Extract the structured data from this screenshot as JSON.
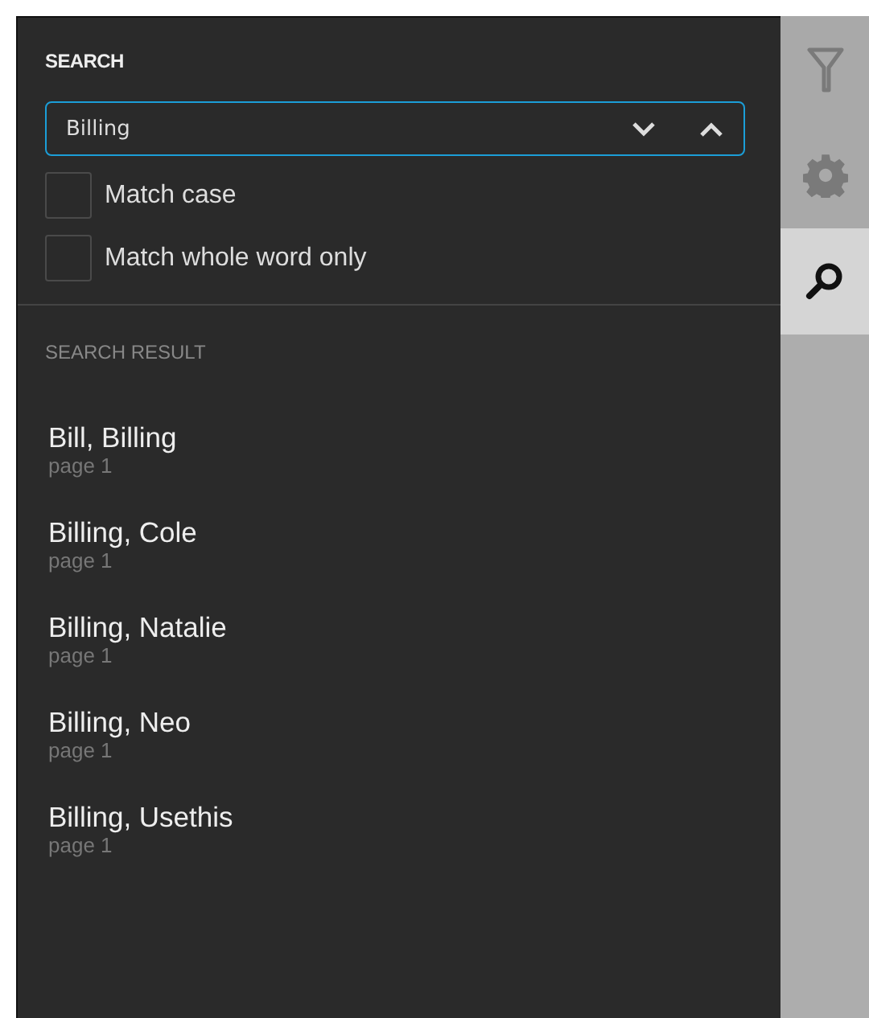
{
  "search": {
    "title": "SEARCH",
    "value": "Billing"
  },
  "options": [
    {
      "label": "Match case",
      "checked": false
    },
    {
      "label": "Match whole word only",
      "checked": false
    }
  ],
  "results_title": "SEARCH RESULT",
  "results": [
    {
      "title": "Bill, Billing",
      "page": "page 1"
    },
    {
      "title": "Billing, Cole",
      "page": "page 1"
    },
    {
      "title": "Billing, Natalie",
      "page": "page 1"
    },
    {
      "title": "Billing, Neo",
      "page": "page 1"
    },
    {
      "title": "Billing, Usethis",
      "page": "page 1"
    }
  ],
  "rail_tabs": [
    {
      "kind": "filter",
      "selected": false
    },
    {
      "kind": "settings",
      "selected": false
    },
    {
      "kind": "search",
      "selected": true
    }
  ]
}
